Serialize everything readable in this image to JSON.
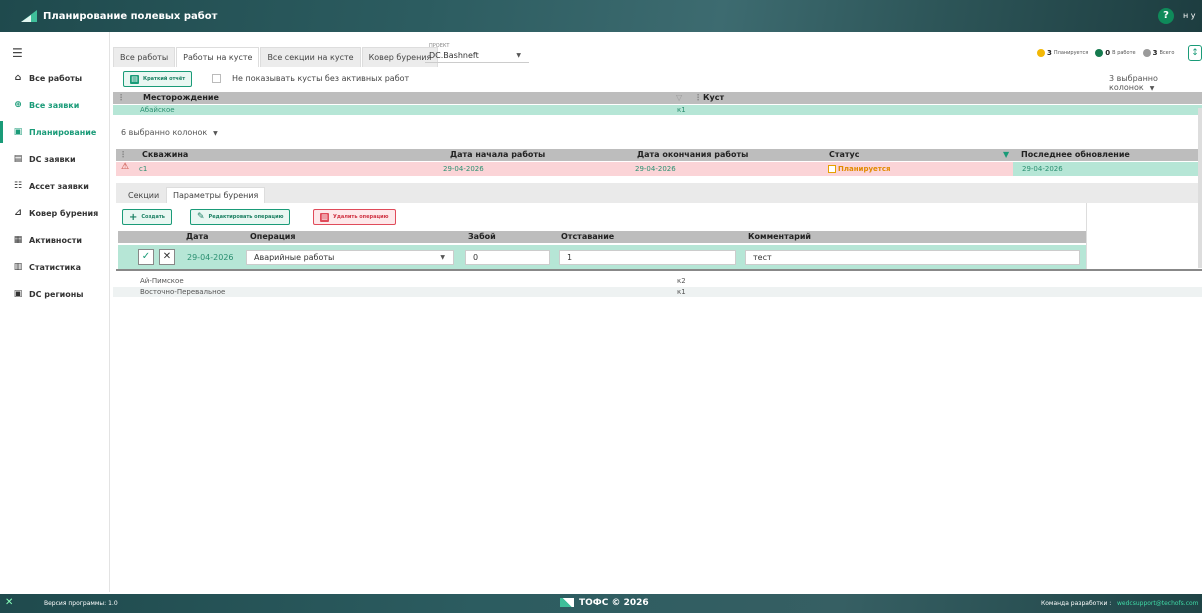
{
  "app": {
    "title": "Планирование полевых работ",
    "help": "?",
    "user": "н у"
  },
  "sidebar": {
    "items": [
      {
        "label": "Все работы",
        "icon": "home-icon"
      },
      {
        "label": "Все заявки",
        "icon": "globe-icon"
      },
      {
        "label": "Планирование",
        "icon": "calendar-icon"
      },
      {
        "label": "DC заявки",
        "icon": "board-icon"
      },
      {
        "label": "Ассет заявки",
        "icon": "list-icon"
      },
      {
        "label": "Ковер бурения",
        "icon": "steps-icon"
      },
      {
        "label": "Активности",
        "icon": "grid-icon"
      },
      {
        "label": "Статистика",
        "icon": "chart-icon"
      },
      {
        "label": "DC регионы",
        "icon": "map-icon"
      }
    ]
  },
  "tabs": [
    "Все работы",
    "Работы на кусте",
    "Все секции на кусте",
    "Ковер бурения"
  ],
  "project": {
    "label": "ПРОЕКТ",
    "value": "DC.Bashneft"
  },
  "counters": [
    {
      "count": "3",
      "label": "Планируется",
      "color": "#f2b705"
    },
    {
      "count": "0",
      "label": "В работе",
      "color": "#157a4e"
    },
    {
      "count": "3",
      "label": "Всего",
      "color": "#9a9a9a"
    }
  ],
  "toolbar": {
    "report": "Краткий отчёт",
    "hide_empty": "Не показывать кусты без активных работ",
    "columns_top": "3 выбранно колонок",
    "columns_wells": "6 выбранно колонок"
  },
  "pads_table": {
    "headers": [
      "Месторождение",
      "Куст"
    ],
    "rows": [
      [
        "Абайское",
        "к1"
      ],
      [
        "Ай-Пимское",
        "к2"
      ],
      [
        "Восточно-Перевальное",
        "к1"
      ]
    ]
  },
  "wells_table": {
    "headers": [
      "Скважина",
      "Дата начала работы",
      "Дата окончания работы",
      "Статус",
      "Последнее обновление"
    ],
    "row": {
      "well": "c1",
      "start": "29-04-2026",
      "end": "29-04-2026",
      "status": "Планируется",
      "updated": "29-04-2026"
    }
  },
  "subtabs": [
    "Секции",
    "Параметры бурения"
  ],
  "ops": {
    "create": "Создать",
    "edit": "Редактировать операцию",
    "delete": "Удалить операцию",
    "headers": [
      "Дата",
      "Операция",
      "Забой",
      "Отставание",
      "Комментарий"
    ],
    "row": {
      "date": "29-04-2026",
      "operation": "Аварийные работы",
      "depth": "0",
      "lag": "1",
      "comment": "тест"
    }
  },
  "footer": {
    "version": "Версия программы: 1.0",
    "brand": "ТОФС © 2026",
    "team_label": "Команда разработки :",
    "team_email": "wedcsupport@techofs.com"
  }
}
